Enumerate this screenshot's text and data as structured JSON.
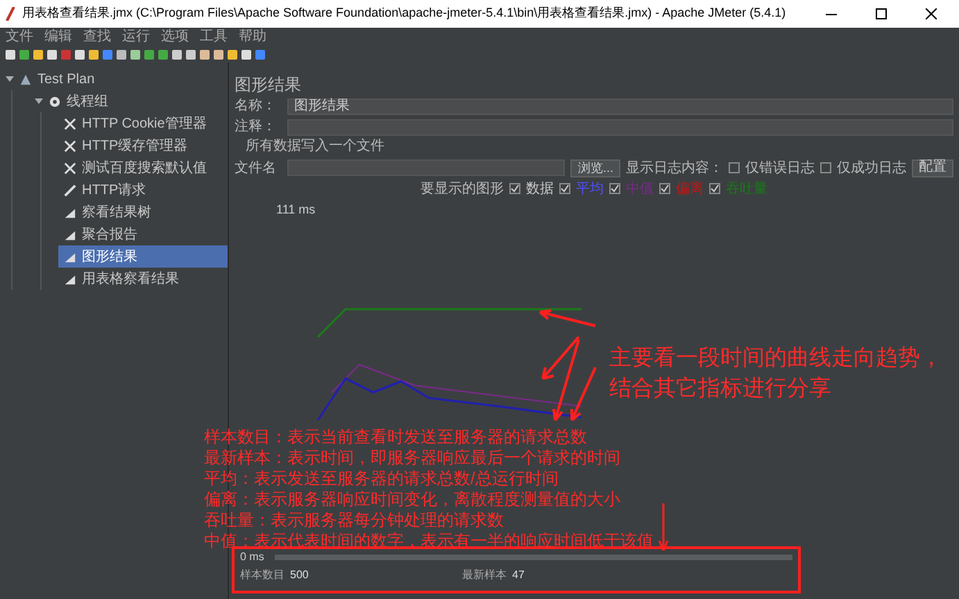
{
  "window": {
    "title": "用表格查看结果.jmx (C:\\Program Files\\Apache Software Foundation\\apache-jmeter-5.4.1\\bin\\用表格查看结果.jmx) - Apache JMeter (5.4.1)"
  },
  "menu": [
    "文件",
    "编辑",
    "查找",
    "运行",
    "选项",
    "工具",
    "帮助"
  ],
  "tree": [
    {
      "label": "Test Plan",
      "kind": "plan",
      "expanded": true,
      "selected": false,
      "children": [
        {
          "label": "线程组",
          "kind": "group",
          "expanded": true,
          "selected": false,
          "children": [
            {
              "label": "HTTP Cookie管理器",
              "kind": "config",
              "selected": false
            },
            {
              "label": "HTTP缓存管理器",
              "kind": "config",
              "selected": false
            },
            {
              "label": "测试百度搜索默认值",
              "kind": "config",
              "selected": false
            },
            {
              "label": "HTTP请求",
              "kind": "sampler",
              "selected": false
            },
            {
              "label": "察看结果树",
              "kind": "listener",
              "selected": false
            },
            {
              "label": "聚合报告",
              "kind": "listener",
              "selected": false
            },
            {
              "label": "图形结果",
              "kind": "listener",
              "selected": true
            },
            {
              "label": "用表格察看结果",
              "kind": "listener",
              "selected": false
            }
          ]
        }
      ]
    }
  ],
  "panel": {
    "title": "图形结果",
    "name_label": "名称：",
    "name_value": "图形结果",
    "comment_label": "注释：",
    "file_section": "所有数据写入一个文件",
    "file_label": "文件名",
    "browse": "浏览...",
    "log_label": "显示日志内容：",
    "errors_only": {
      "label": "仅错误日志",
      "checked": false
    },
    "success_only": {
      "label": "仅成功日志",
      "checked": false
    },
    "configure": "配置",
    "graphs_label": "要显示的图形",
    "graphs": [
      {
        "label": "数据",
        "checked": true,
        "color": "#c8c8c8"
      },
      {
        "label": "平均",
        "checked": true,
        "color": "#5050ff"
      },
      {
        "label": "中值",
        "checked": true,
        "color": "#7a2a8a"
      },
      {
        "label": "偏离",
        "checked": true,
        "color": "#c01818"
      },
      {
        "label": "吞吐量",
        "checked": true,
        "color": "#1a7a1a"
      }
    ],
    "y_max": "111 ms",
    "y_min": "0 ms",
    "stats": [
      {
        "label": "样本数目",
        "value": "500"
      },
      {
        "label": "最新样本",
        "value": "47"
      }
    ]
  },
  "annotations": {
    "trend_note": [
      "主要看一段时间的曲线走向趋势，",
      "结合其它指标进行分享"
    ],
    "definitions": [
      "样本数目：表示当前查看时发送至服务器的请求总数",
      "最新样本：表示时间，即服务器响应最后一个请求的时间",
      "平均：表示发送至服务器的请求总数/总运行时间",
      "偏离：表示服务器响应时间变化，离散程度测量值的大小",
      "吞吐量：表示服务器每分钟处理的请求数",
      "中值：表示代表时间的数字，表示有一半的响应时间低于该值"
    ]
  }
}
